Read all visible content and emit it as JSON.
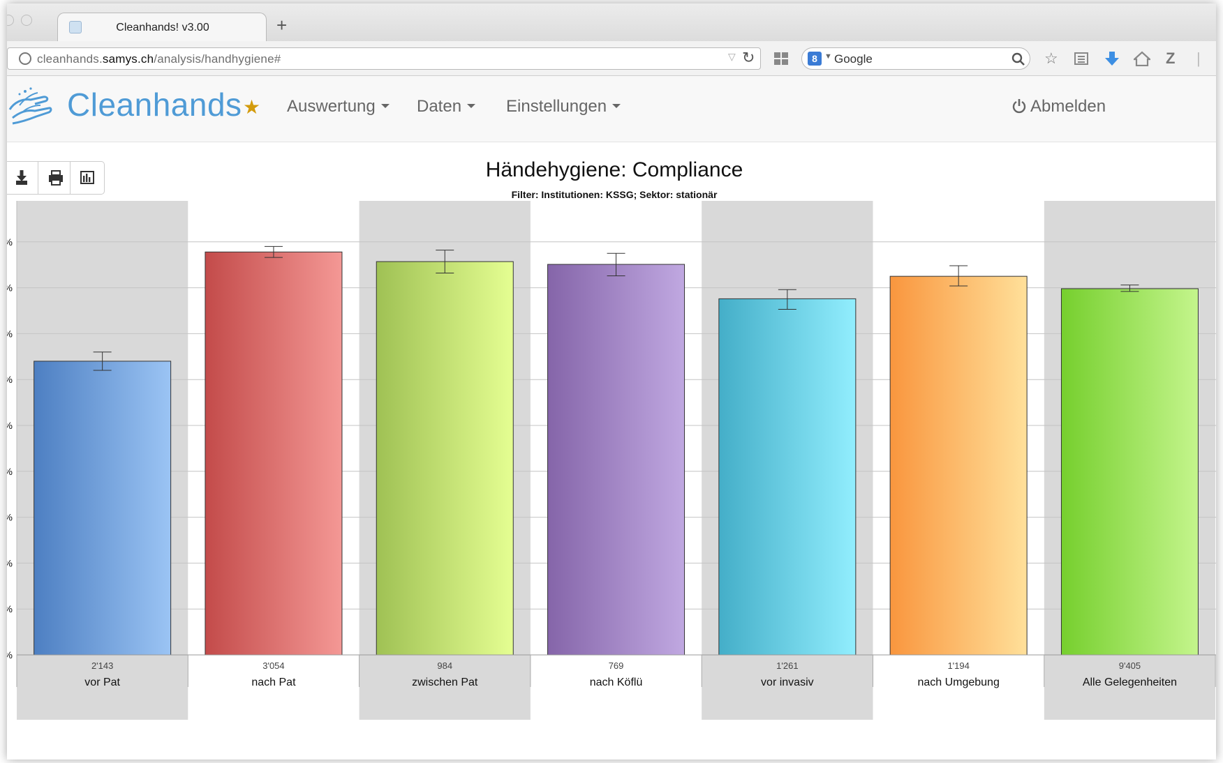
{
  "browser": {
    "tab_title": "Cleanhands! v3.00",
    "new_tab": "+",
    "url_prefix": "cleanhands.",
    "url_domain": "samys.ch",
    "url_path": "/analysis/handhygiene#",
    "search_engine": "Google"
  },
  "app": {
    "brand": "Cleanhands",
    "menu": [
      "Auswertung",
      "Daten",
      "Einstellungen"
    ],
    "logout": "Abmelden",
    "brand_color": "#4f9bd6",
    "star_color": "#d39b0c"
  },
  "chart_data": {
    "type": "bar",
    "title": "Händehygiene: Compliance",
    "subtitle": "Filter: Institutionen: KSSG; Sektor: stationär",
    "ylim": [
      0,
      100
    ],
    "ytick_suffix": "%",
    "grid": true,
    "categories": [
      "vor Pat",
      "nach Pat",
      "zwischen Pat",
      "nach Köflü",
      "vor invasiv",
      "nach Umgebung",
      "Alle Gelegenheiten"
    ],
    "counts": [
      "2'143",
      "3'054",
      "984",
      "769",
      "1'261",
      "1'194",
      "9'405"
    ],
    "values": [
      64,
      87.8,
      85.7,
      85.1,
      77.6,
      82.5,
      79.8
    ],
    "error_low": [
      62,
      86.6,
      83.2,
      82.6,
      75.3,
      80.4,
      79.2
    ],
    "error_high": [
      66,
      89,
      88.2,
      87.5,
      79.6,
      84.8,
      80.6
    ],
    "colors": [
      [
        "#4d7fc2",
        "#9bc4f4"
      ],
      [
        "#c34b4a",
        "#f49895"
      ],
      [
        "#9fc154",
        "#e5fe92"
      ],
      [
        "#8565a9",
        "#c0a8e1"
      ],
      [
        "#44aec8",
        "#92eefe"
      ],
      [
        "#f9963e",
        "#ffe09a"
      ],
      [
        "#76cf2e",
        "#c4f58c"
      ]
    ]
  }
}
